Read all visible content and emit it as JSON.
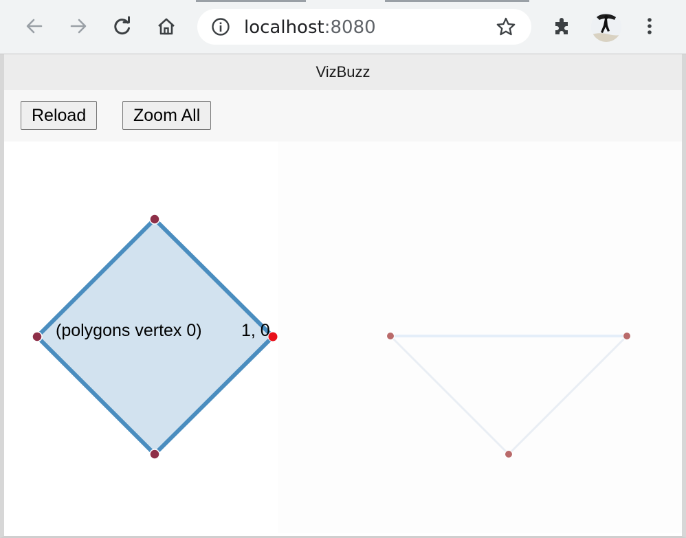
{
  "browser": {
    "address_host": "localhost",
    "address_port": ":8080",
    "nav_icons": [
      "back-icon",
      "forward-icon",
      "reload-icon",
      "home-icon"
    ],
    "toolbar_icons": [
      "info-icon",
      "star-icon",
      "extensions-icon",
      "profile-avatar",
      "menu-icon"
    ]
  },
  "app": {
    "title": "VizBuzz",
    "buttons": {
      "reload": "Reload",
      "zoom_all": "Zoom All"
    }
  },
  "scene": {
    "polygon_label": "(polygons vertex 0)",
    "coord_label": "1, 0",
    "colors": {
      "polygon_fill": "#d2e2ef",
      "polygon_stroke": "#4a8dbf",
      "vertex": "#8e2f48",
      "highlight_vertex": "#e8101a",
      "ghost_stroke": "#e6eef7",
      "ghost_vertex": "#b96a6a"
    }
  }
}
